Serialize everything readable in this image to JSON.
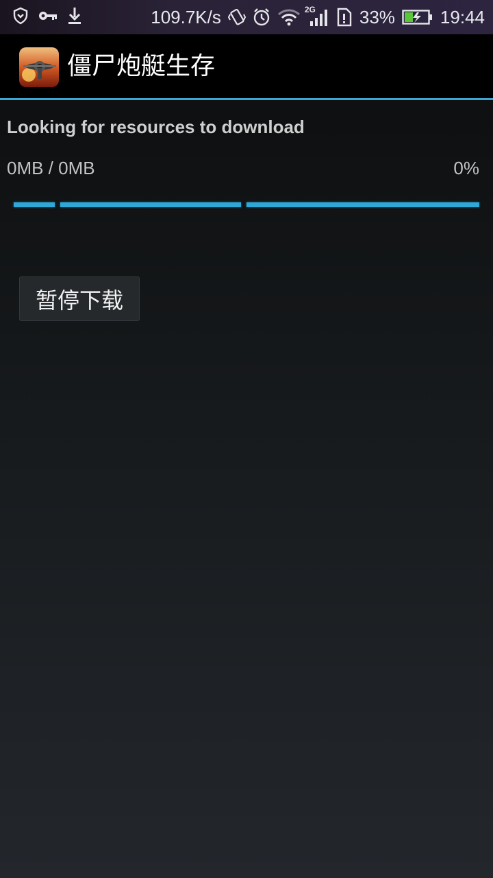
{
  "status_bar": {
    "left_icons": [
      "shield-icon",
      "key-icon",
      "download-icon"
    ],
    "network_speed": "109.7K/s",
    "network_type": "2G",
    "battery_percent": "33%",
    "time": "19:44",
    "right_icons": [
      "vibrate-icon",
      "alarm-icon",
      "wifi-icon",
      "signal-icon",
      "sim-icon",
      "battery-charging-icon"
    ]
  },
  "action_bar": {
    "app_title": "僵尸炮艇生存",
    "app_icon": "game-app-icon",
    "divider_color": "#3ba6d4"
  },
  "download": {
    "status": "Looking for resources to download",
    "size_progress": "0MB / 0MB",
    "percent": "0%",
    "progress_color": "#2fa8d8",
    "pause_button_label": "暂停下载"
  }
}
